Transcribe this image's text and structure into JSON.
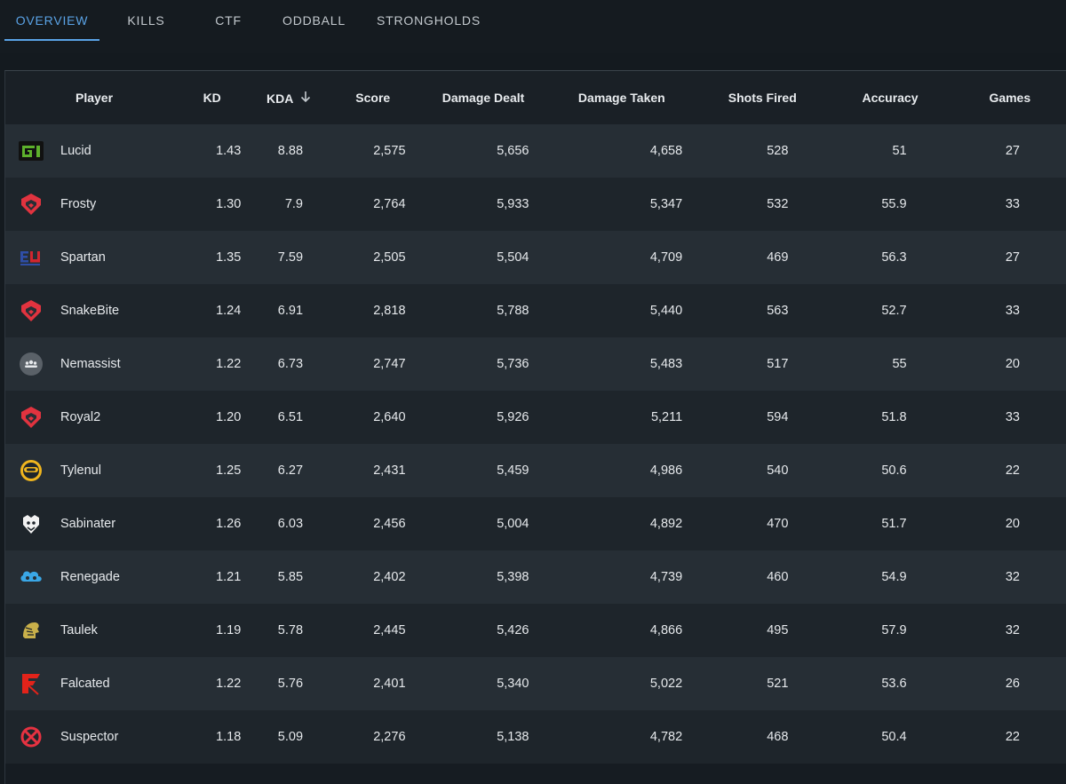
{
  "tabs": [
    {
      "label": "OVERVIEW",
      "active": true
    },
    {
      "label": "KILLS",
      "active": false
    },
    {
      "label": "CTF",
      "active": false
    },
    {
      "label": "ODDBALL",
      "active": false
    },
    {
      "label": "STRONGHOLDS",
      "active": false
    }
  ],
  "table": {
    "headers": {
      "player": "Player",
      "kd": "KD",
      "kda": "KDA",
      "score": "Score",
      "damage_dealt": "Damage Dealt",
      "damage_taken": "Damage Taken",
      "shots_fired": "Shots Fired",
      "accuracy": "Accuracy",
      "games": "Games"
    },
    "sort": {
      "column": "kda",
      "direction": "desc"
    },
    "rows": [
      {
        "team_logo": "optic-logo-icon",
        "player": "Lucid",
        "kd": "1.43",
        "kda": "8.88",
        "score": "2,575",
        "damage_dealt": "5,656",
        "damage_taken": "4,658",
        "shots_fired": "528",
        "accuracy": "51",
        "games": "27"
      },
      {
        "team_logo": "sentinels-logo-icon",
        "player": "Frosty",
        "kd": "1.30",
        "kda": "7.9",
        "score": "2,764",
        "damage_dealt": "5,933",
        "damage_taken": "5,347",
        "shots_fired": "532",
        "accuracy": "55.9",
        "games": "33"
      },
      {
        "team_logo": "eunited-logo-icon",
        "player": "Spartan",
        "kd": "1.35",
        "kda": "7.59",
        "score": "2,505",
        "damage_dealt": "5,504",
        "damage_taken": "4,709",
        "shots_fired": "469",
        "accuracy": "56.3",
        "games": "27"
      },
      {
        "team_logo": "sentinels-logo-icon",
        "player": "SnakeBite",
        "kd": "1.24",
        "kda": "6.91",
        "score": "2,818",
        "damage_dealt": "5,788",
        "damage_taken": "5,440",
        "shots_fired": "563",
        "accuracy": "52.7",
        "games": "33"
      },
      {
        "team_logo": "generic-team-icon",
        "player": "Nemassist",
        "kd": "1.22",
        "kda": "6.73",
        "score": "2,747",
        "damage_dealt": "5,736",
        "damage_taken": "5,483",
        "shots_fired": "517",
        "accuracy": "55",
        "games": "20"
      },
      {
        "team_logo": "sentinels-logo-icon",
        "player": "Royal2",
        "kd": "1.20",
        "kda": "6.51",
        "score": "2,640",
        "damage_dealt": "5,926",
        "damage_taken": "5,211",
        "shots_fired": "594",
        "accuracy": "51.8",
        "games": "33"
      },
      {
        "team_logo": "spacestation-logo-icon",
        "player": "Tylenul",
        "kd": "1.25",
        "kda": "6.27",
        "score": "2,431",
        "damage_dealt": "5,459",
        "damage_taken": "4,986",
        "shots_fired": "540",
        "accuracy": "50.6",
        "games": "22"
      },
      {
        "team_logo": "g2-logo-icon",
        "player": "Sabinater",
        "kd": "1.26",
        "kda": "6.03",
        "score": "2,456",
        "damage_dealt": "5,004",
        "damage_taken": "4,892",
        "shots_fired": "470",
        "accuracy": "51.7",
        "games": "20"
      },
      {
        "team_logo": "cloud9-logo-icon",
        "player": "Renegade",
        "kd": "1.21",
        "kda": "5.85",
        "score": "2,402",
        "damage_dealt": "5,398",
        "damage_taken": "4,739",
        "shots_fired": "460",
        "accuracy": "54.9",
        "games": "32"
      },
      {
        "team_logo": "kings-logo-icon",
        "player": "Taulek",
        "kd": "1.19",
        "kda": "5.78",
        "score": "2,445",
        "damage_dealt": "5,426",
        "damage_taken": "4,866",
        "shots_fired": "495",
        "accuracy": "57.9",
        "games": "32"
      },
      {
        "team_logo": "faze-logo-icon",
        "player": "Falcated",
        "kd": "1.22",
        "kda": "5.76",
        "score": "2,401",
        "damage_dealt": "5,340",
        "damage_taken": "5,022",
        "shots_fired": "521",
        "accuracy": "53.6",
        "games": "26"
      },
      {
        "team_logo": "xset-logo-icon",
        "player": "Suspector",
        "kd": "1.18",
        "kda": "5.09",
        "score": "2,276",
        "damage_dealt": "5,138",
        "damage_taken": "4,782",
        "shots_fired": "468",
        "accuracy": "50.4",
        "games": "22"
      }
    ]
  },
  "colors": {
    "accent": "#5aa3e6",
    "optic": "#5db02c",
    "sentinels": "#e1333f",
    "eunited_blue": "#2f4ea6",
    "eunited_red": "#d1262f",
    "spacestation": "#f0b51e",
    "cloud9": "#3aa7e6",
    "kings": "#c9b04a",
    "faze": "#e2231a",
    "xset": "#e63241"
  }
}
